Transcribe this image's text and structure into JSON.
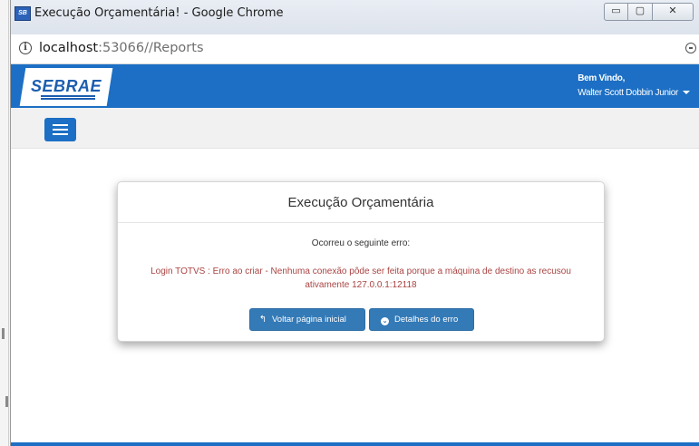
{
  "browser": {
    "window_title": "Execução Orçamentária! - Google Chrome",
    "window_controls": {
      "minimize": "▭",
      "maximize": "▢",
      "close": "✕"
    },
    "url_host": "localhost",
    "url_rest": ":53066//Reports",
    "info_icon": "i"
  },
  "header": {
    "logo_text": "SEBRAE",
    "greeting": "Bem Vindo,",
    "user_name": "Walter Scott Dobbin Junior",
    "brand_color": "#1c6fc4"
  },
  "dialog": {
    "title": "Execução Orçamentária",
    "subtitle": "Ocorreu o seguinte erro:",
    "error_message": "Login TOTVS : Erro ao criar - Nenhuma conexão pôde ser feita porque a máquina de destino as recusou ativamente 127.0.0.1:12118",
    "back_button_label": "Voltar página inicial",
    "details_button_label": "Detalhes do erro",
    "error_color": "#a94442",
    "button_color": "#337ab7"
  }
}
